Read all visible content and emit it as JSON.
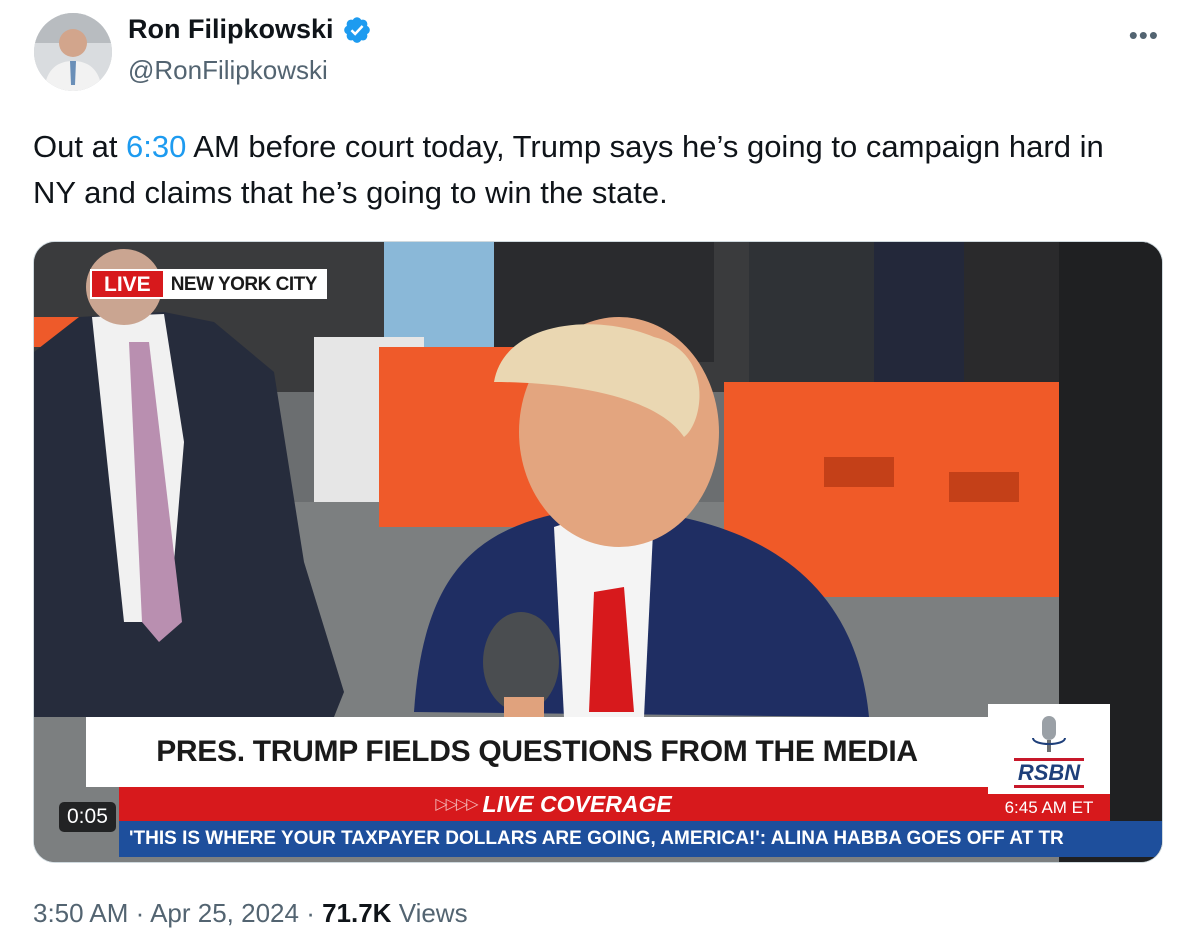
{
  "author": {
    "display_name": "Ron Filipkowski",
    "handle": "@RonFilipkowski",
    "verified": true,
    "verified_color": "#1d9bf0"
  },
  "more_icon": "more-horizontal-icon",
  "tweet": {
    "text_before": "Out at ",
    "text_link": "6:30",
    "text_after": " AM before court today, Trump says he’s going to campaign hard in NY and claims that he’s going to win the state."
  },
  "video": {
    "live_label": "LIVE",
    "location_label": "NEW YORK CITY",
    "headline": "PRES. TRUMP FIELDS QUESTIONS FROM THE MEDIA",
    "live_coverage": "LIVE COVERAGE",
    "live_coverage_arrows": "▷▷▷▷",
    "network": "RSBN",
    "broadcast_time": "6:45 AM ET",
    "ticker": "'THIS IS WHERE YOUR TAXPAYER DOLLARS ARE GOING, AMERICA!': ALINA HABBA GOES OFF AT TR",
    "duration": "0:05"
  },
  "meta": {
    "time": "3:50 AM",
    "separator": " · ",
    "date": "Apr 25, 2024",
    "views_count": "71.7K",
    "views_label": " Views"
  },
  "colors": {
    "link": "#1d9bf0",
    "secondary_text": "#536471",
    "live_red": "#d7191c",
    "ticker_blue": "#1e4f9c"
  }
}
